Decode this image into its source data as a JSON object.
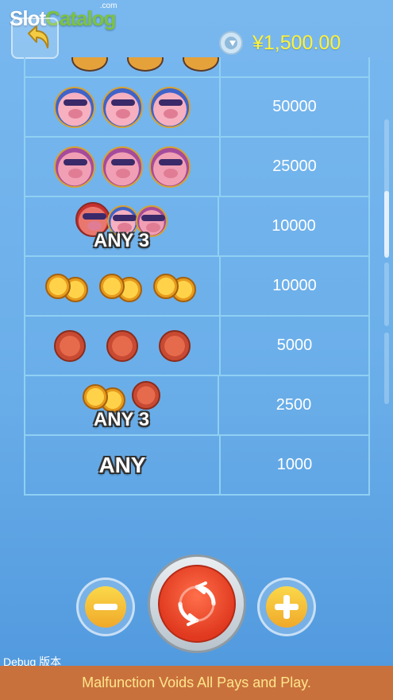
{
  "brand": {
    "part1": "Slot",
    "part2": "Catalog",
    "suffix": ".com"
  },
  "header": {
    "balance": "¥1,500.00"
  },
  "paytable": {
    "rows": [
      {
        "symbols": "blue-pig-x3",
        "any": "",
        "pay": "50000"
      },
      {
        "symbols": "pink-pig-x3",
        "any": "",
        "pay": "25000"
      },
      {
        "symbols": "mixed-pigs",
        "any": "ANY 3",
        "pay": "10000"
      },
      {
        "symbols": "gold-coins-x3",
        "any": "",
        "pay": "10000"
      },
      {
        "symbols": "red-coins-x3",
        "any": "",
        "pay": "5000"
      },
      {
        "symbols": "mixed-coins",
        "any": "ANY 3",
        "pay": "2500"
      },
      {
        "symbols": "any",
        "any": "ANY",
        "pay": "1000"
      }
    ]
  },
  "footer": {
    "debug": "Debug 版本",
    "notice": "Malfunction Voids All Pays and Play."
  },
  "colors": {
    "balance": "#fff23a",
    "footer_bg": "#c9713d",
    "footer_text": "#ffe58a",
    "grid": "#8fd0f3"
  }
}
